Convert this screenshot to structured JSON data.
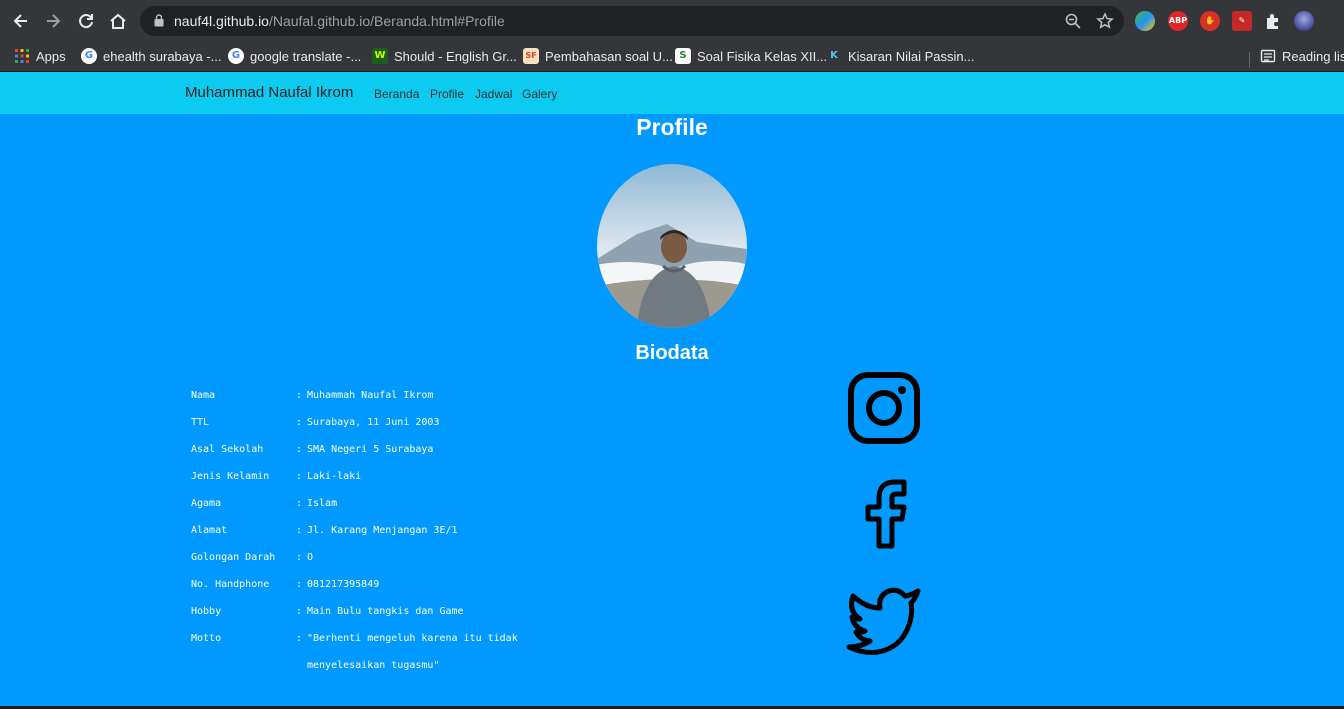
{
  "browser": {
    "url_host": "nauf4l.github.io",
    "url_path": "/Naufal.github.io/Beranda.html#Profile",
    "bookmarks": [
      {
        "label": "Apps",
        "icon": "apps-grid-icon"
      },
      {
        "label": "ehealth surabaya -...",
        "icon": "google-icon"
      },
      {
        "label": "google translate -...",
        "icon": "google-icon"
      },
      {
        "label": "Should - English Gr...",
        "icon": "wordreference-icon"
      },
      {
        "label": "Pembahasan soal U...",
        "icon": "sf-icon"
      },
      {
        "label": "Soal Fisika Kelas XII...",
        "icon": "leaf-icon"
      },
      {
        "label": "Kisaran Nilai Passin...",
        "icon": "k-icon"
      }
    ],
    "reading_list": "Reading list",
    "extensions": [
      {
        "name": "color-extension-icon",
        "color": "#4caf50",
        "text": ""
      },
      {
        "name": "adblock-plus-icon",
        "color": "#e0262a",
        "text": "ABP"
      },
      {
        "name": "stop-hand-icon",
        "color": "#d93025",
        "text": "✋"
      },
      {
        "name": "stylus-icon",
        "color": "#c62828",
        "text": "✎"
      }
    ]
  },
  "navbar": {
    "brand": "Muhammad Naufal Ikrom",
    "links": [
      "Beranda",
      "Profile",
      "Jadwal",
      "Galery"
    ]
  },
  "profile": {
    "title": "Profile",
    "subtitle": "Biodata"
  },
  "biodata": [
    {
      "label": "Nama",
      "value": "Muhammah Naufal Ikrom"
    },
    {
      "label": "TTL",
      "value": "Surabaya, 11 Juni 2003"
    },
    {
      "label": "Asal Sekolah",
      "value": "SMA Negeri 5 Surabaya"
    },
    {
      "label": "Jenis Kelamin",
      "value": "Laki-laki"
    },
    {
      "label": "Agama",
      "value": "Islam"
    },
    {
      "label": "Alamat",
      "value": "Jl. Karang Menjangan 3E/1"
    },
    {
      "label": "Golongan Darah",
      "value": "O"
    },
    {
      "label": "No. Handphone",
      "value": "081217395849"
    },
    {
      "label": "Hobby",
      "value": "Main Bulu tangkis dan Game"
    },
    {
      "label": "Motto",
      "value": "\"Berhenti mengeluh karena itu tidak"
    }
  ],
  "motto_continued": "menyelesaikan tugasmu\"",
  "colon": ":",
  "social": [
    "instagram-icon",
    "facebook-icon",
    "twitter-icon"
  ],
  "colors": {
    "page_bg": "#0099ff",
    "navbar_bg": "#0dcaf0",
    "chrome_bg": "#35363a"
  }
}
